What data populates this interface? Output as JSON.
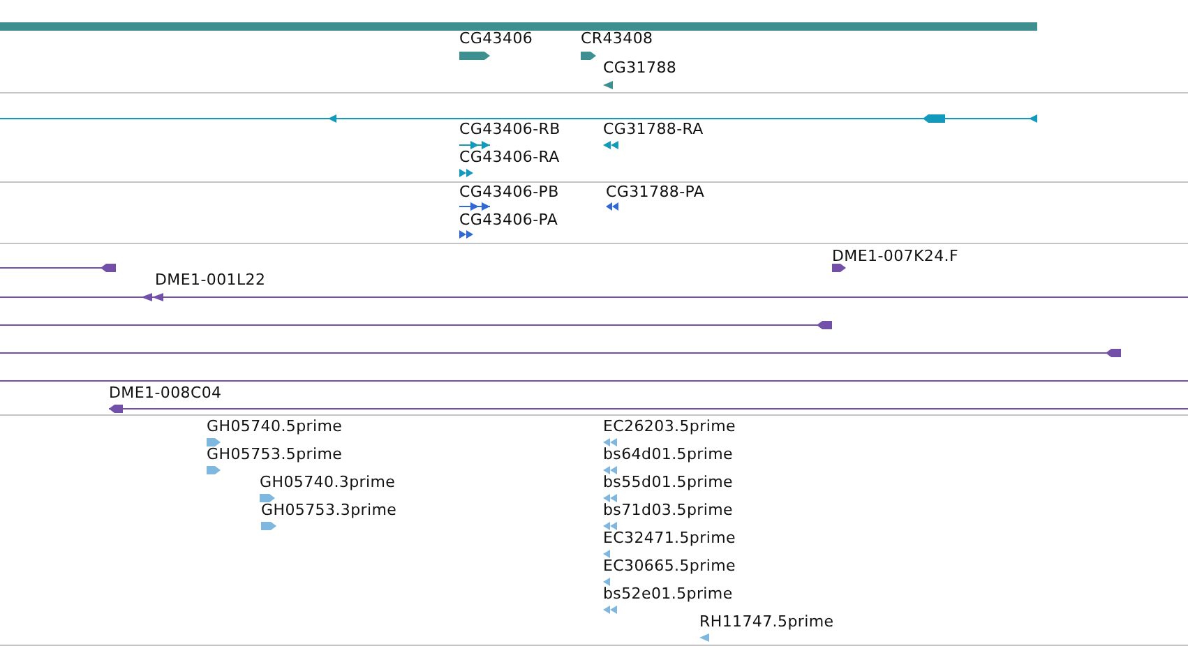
{
  "tracks": [
    {
      "color": "#3e8f8f",
      "features": [
        {
          "kind": "bar"
        },
        {
          "label": "CG43406",
          "kind": "block",
          "reverse": false
        },
        {
          "label": "CR43408",
          "kind": "block",
          "reverse": false
        },
        {
          "label": "CG31788",
          "kind": "arrow",
          "reverse": true
        }
      ]
    },
    {
      "color": "#1299bb",
      "features": [
        {
          "kind": "span",
          "reverse": true
        },
        {
          "label": "CG43406-RB",
          "kind": "transcript",
          "reverse": false
        },
        {
          "label": "CG43406-RA",
          "kind": "chevrons",
          "reverse": false
        },
        {
          "label": "CG31788-RA",
          "kind": "chevrons",
          "reverse": true
        }
      ]
    },
    {
      "color": "#3168d2",
      "features": [
        {
          "label": "CG43406-PB",
          "kind": "transcript",
          "reverse": false
        },
        {
          "label": "CG43406-PA",
          "kind": "chevrons",
          "reverse": false
        },
        {
          "label": "CG31788-PA",
          "kind": "chevrons",
          "reverse": true
        }
      ]
    },
    {
      "color": "#7250a8",
      "features": [
        {
          "kind": "span",
          "reverse": true
        },
        {
          "label": "DME1-007K24.F",
          "kind": "block",
          "reverse": false
        },
        {
          "label": "DME1-001L22",
          "kind": "span",
          "reverse": true
        },
        {
          "kind": "span",
          "reverse": true
        },
        {
          "kind": "span",
          "reverse": true
        },
        {
          "kind": "line"
        },
        {
          "label": "DME1-008C04",
          "kind": "span",
          "reverse": true
        }
      ]
    },
    {
      "color": "#80b7de",
      "features": [
        {
          "label": "GH05740.5prime",
          "kind": "block",
          "reverse": false
        },
        {
          "label": "GH05753.5prime",
          "kind": "block",
          "reverse": false
        },
        {
          "label": "GH05740.3prime",
          "kind": "block",
          "reverse": false
        },
        {
          "label": "GH05753.3prime",
          "kind": "block",
          "reverse": false
        },
        {
          "label": "EC26203.5prime",
          "kind": "chevrons",
          "reverse": true
        },
        {
          "label": "bs64d01.5prime",
          "kind": "chevrons",
          "reverse": true
        },
        {
          "label": "bs55d01.5prime",
          "kind": "chevrons",
          "reverse": true
        },
        {
          "label": "bs71d03.5prime",
          "kind": "chevrons",
          "reverse": true
        },
        {
          "label": "EC32471.5prime",
          "kind": "arrow",
          "reverse": true
        },
        {
          "label": "EC30665.5prime",
          "kind": "arrow",
          "reverse": true
        },
        {
          "label": "bs52e01.5prime",
          "kind": "chevrons",
          "reverse": true
        },
        {
          "label": "RH11747.5prime",
          "kind": "arrow",
          "reverse": true
        }
      ]
    }
  ]
}
